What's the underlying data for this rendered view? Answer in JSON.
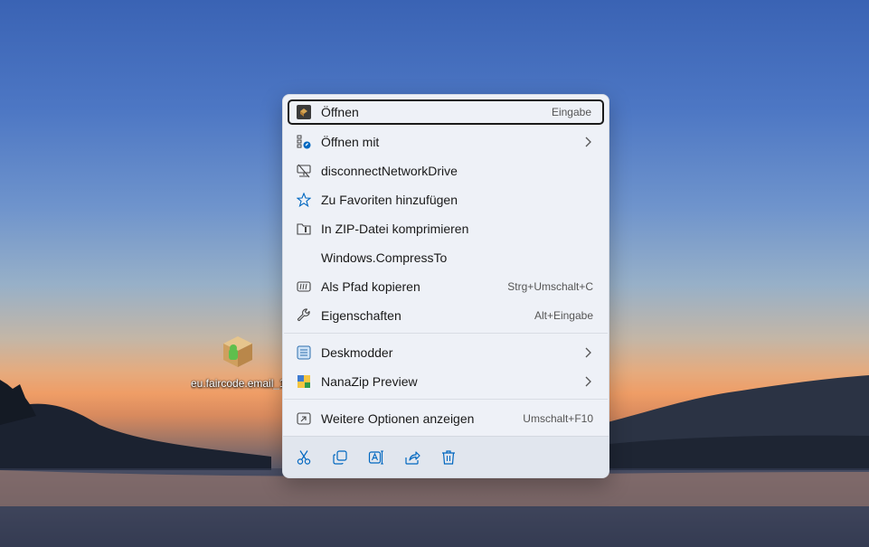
{
  "desktop": {
    "icon_label": "eu.faircode.email_1"
  },
  "context_menu": {
    "items": [
      {
        "label": "Öffnen",
        "accelerator": "Eingabe",
        "icon": "app-package-icon"
      },
      {
        "label": "Öffnen mit",
        "accelerator": "",
        "icon": "open-with-icon",
        "submenu": true
      },
      {
        "label": "disconnectNetworkDrive",
        "accelerator": "",
        "icon": "disconnect-network-drive-icon"
      },
      {
        "label": "Zu Favoriten hinzufügen",
        "accelerator": "",
        "icon": "star-icon"
      },
      {
        "label": "In ZIP-Datei komprimieren",
        "accelerator": "",
        "icon": "zip-folder-icon"
      },
      {
        "label": "Windows.CompressTo",
        "accelerator": "",
        "icon": ""
      },
      {
        "label": "Als Pfad kopieren",
        "accelerator": "Strg+Umschalt+C",
        "icon": "copy-path-icon"
      },
      {
        "label": "Eigenschaften",
        "accelerator": "Alt+Eingabe",
        "icon": "wrench-icon"
      },
      {
        "label": "Deskmodder",
        "accelerator": "",
        "icon": "deskmodder-icon",
        "submenu": true
      },
      {
        "label": "NanaZip Preview",
        "accelerator": "",
        "icon": "nanazip-icon",
        "submenu": true
      },
      {
        "label": "Weitere Optionen anzeigen",
        "accelerator": "Umschalt+F10",
        "icon": "show-more-options-icon"
      }
    ],
    "toolbar": [
      "cut-icon",
      "copy-icon",
      "rename-icon",
      "share-icon",
      "delete-icon"
    ],
    "accent_color": "#0067c0"
  }
}
